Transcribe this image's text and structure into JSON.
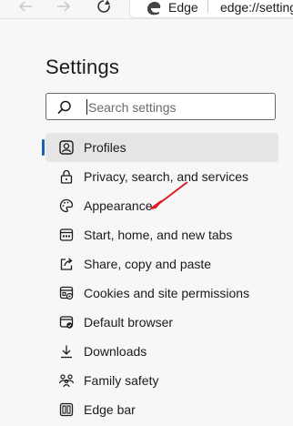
{
  "browser": {
    "tab_label": "Edge",
    "address": "edge://settings"
  },
  "settings": {
    "title": "Settings",
    "search_placeholder": "Search settings",
    "selected_item": "Profiles",
    "items": [
      {
        "label": "Profiles",
        "icon": "profile-icon"
      },
      {
        "label": "Privacy, search, and services",
        "icon": "lock-icon"
      },
      {
        "label": "Appearance",
        "icon": "palette-icon"
      },
      {
        "label": "Start, home, and new tabs",
        "icon": "home-tabs-icon"
      },
      {
        "label": "Share, copy and paste",
        "icon": "share-icon"
      },
      {
        "label": "Cookies and site permissions",
        "icon": "cookies-icon"
      },
      {
        "label": "Default browser",
        "icon": "browser-icon"
      },
      {
        "label": "Downloads",
        "icon": "download-icon"
      },
      {
        "label": "Family safety",
        "icon": "family-icon"
      },
      {
        "label": "Edge bar",
        "icon": "edge-bar-icon"
      }
    ]
  },
  "annotation": {
    "arrow_color": "#e01b24",
    "points_to": "Appearance"
  },
  "colors": {
    "accent": "#1a5fb4",
    "selected_bg": "#e5e5e5"
  }
}
